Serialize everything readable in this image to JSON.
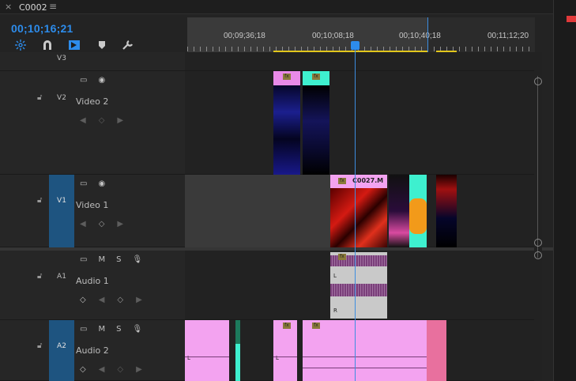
{
  "header": {
    "close": "×",
    "sequence": "C0002",
    "menu": "≡"
  },
  "timecode": "00;10;16;21",
  "tools": [
    "snap-icon",
    "linked-selection-icon",
    "add-edit-icon",
    "marker-icon",
    "wrench-icon"
  ],
  "ruler": {
    "labels": [
      "00;09;36;18",
      "00;10;08;18",
      "00;10;40;18",
      "00;11;12;20"
    ]
  },
  "tracks": {
    "v3": {
      "id": "V3"
    },
    "v2": {
      "id": "V2",
      "name": "Video 2"
    },
    "v1": {
      "id": "V1",
      "name": "Video 1"
    },
    "a1": {
      "id": "A1",
      "name": "Audio 1",
      "m": "M",
      "s": "S"
    },
    "a2": {
      "id": "A2",
      "name": "Audio 2",
      "m": "M",
      "s": "S"
    }
  },
  "clips": {
    "v1_main_label": "C0027.M",
    "fx": "fx",
    "ch_l": "L",
    "ch_r": "R"
  },
  "colors": {
    "accent": "#2d8ceb",
    "audio_pink": "#f3a3f0",
    "cyan": "#3ef0cf",
    "playhead": "#3d8de0",
    "workbar": "#e2c61c"
  }
}
